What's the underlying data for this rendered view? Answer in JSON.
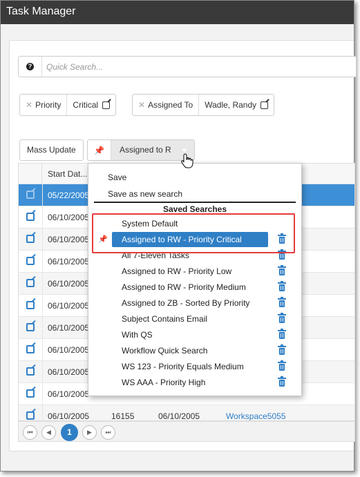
{
  "window": {
    "title": "Task Manager"
  },
  "search": {
    "placeholder": "Quick Search..."
  },
  "filters": [
    {
      "field": "Priority",
      "value": "Critical"
    },
    {
      "field": "Assigned To",
      "value": "Wadle, Randy"
    }
  ],
  "toolbar": {
    "mass_update_label": "Mass Update",
    "saved_search_label": "Assigned to R"
  },
  "grid": {
    "column_header": "Start Dat...",
    "rows": [
      {
        "date": "05/22/2005",
        "c3": "",
        "c4": "",
        "c5": "",
        "selected": true
      },
      {
        "date": "06/10/2005",
        "c3": "",
        "c4": "",
        "c5": ""
      },
      {
        "date": "06/10/2005",
        "c3": "",
        "c4": "",
        "c5": ""
      },
      {
        "date": "06/10/2005",
        "c3": "",
        "c4": "",
        "c5": ""
      },
      {
        "date": "06/10/2005",
        "c3": "",
        "c4": "",
        "c5": ""
      },
      {
        "date": "06/10/2005",
        "c3": "",
        "c4": "",
        "c5": ""
      },
      {
        "date": "06/10/2005",
        "c3": "",
        "c4": "",
        "c5": ""
      },
      {
        "date": "06/10/2005",
        "c3": "",
        "c4": "",
        "c5": ""
      },
      {
        "date": "06/10/2005",
        "c3": "",
        "c4": "",
        "c5": ""
      },
      {
        "date": "06/10/2005",
        "c3": "",
        "c4": "",
        "c5": ""
      },
      {
        "date": "06/10/2005",
        "c3": "16155",
        "c4": "06/10/2005",
        "c5": "Workspace5055"
      }
    ]
  },
  "pager": {
    "current_page": "1"
  },
  "dropdown": {
    "save_label": "Save",
    "save_as_new_label": "Save as new search",
    "saved_heading": "Saved Searches",
    "saved_searches": [
      {
        "label": "System Default",
        "deletable": false
      },
      {
        "label": "Assigned to RW - Priority Critical",
        "deletable": true,
        "active": true,
        "pinned": true
      },
      {
        "label": "All 7-Eleven Tasks",
        "deletable": true
      },
      {
        "label": "Assigned to RW - Priority Low",
        "deletable": true
      },
      {
        "label": "Assigned to RW - Priority Medium",
        "deletable": true
      },
      {
        "label": "Assigned to ZB - Sorted By Priority",
        "deletable": true
      },
      {
        "label": "Subject Contains Email",
        "deletable": true
      },
      {
        "label": "With QS",
        "deletable": true
      },
      {
        "label": "Workflow Quick Search",
        "deletable": true
      },
      {
        "label": "WS 123 - Priority Equals Medium",
        "deletable": true
      },
      {
        "label": "WS AAA - Priority High",
        "deletable": true
      }
    ]
  },
  "colors": {
    "accent": "#2f7fc6",
    "titlebar": "#3a3a3a",
    "highlight": "#e53a3a"
  }
}
